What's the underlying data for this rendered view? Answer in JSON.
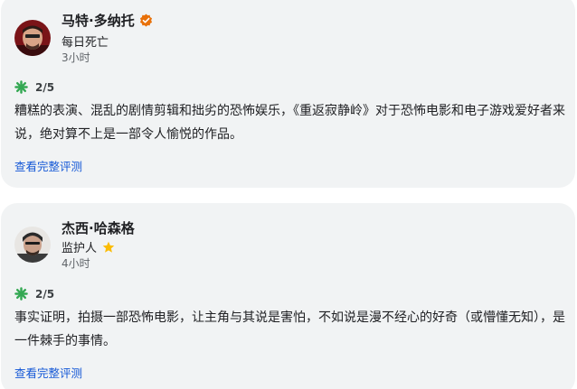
{
  "reviews": [
    {
      "author": "马特·多纳托",
      "source": "每日死亡",
      "time": "3小时",
      "score": "2/5",
      "text": "糟糕的表演、混乱的剧情剪辑和拙劣的恐怖娱乐，《重返寂静岭》对于恐怖电影和电子游戏爱好者来说，绝对算不上是一部令人愉悦的作品。",
      "link": "查看完整评测",
      "icons": {
        "avatar": "author-photo",
        "badge": "verified-icon",
        "score": "splat-icon"
      }
    },
    {
      "author": "杰西·哈森格",
      "source": "监护人",
      "time": "4小时",
      "score": "2/5",
      "text": "事实证明，拍摄一部恐怖电影，让主角与其说是害怕，不如说是漫不经心的好奇（或懵懂无知），是一件棘手的事情。",
      "link": "查看完整评测",
      "icons": {
        "avatar": "author-photo",
        "badge": "star-icon",
        "score": "splat-icon"
      }
    }
  ],
  "colors": {
    "card_bg": "#f1f3f4",
    "link": "#1558d6",
    "splat": "#34a853",
    "verified": "#e8710a",
    "star": "#fbbc04"
  }
}
